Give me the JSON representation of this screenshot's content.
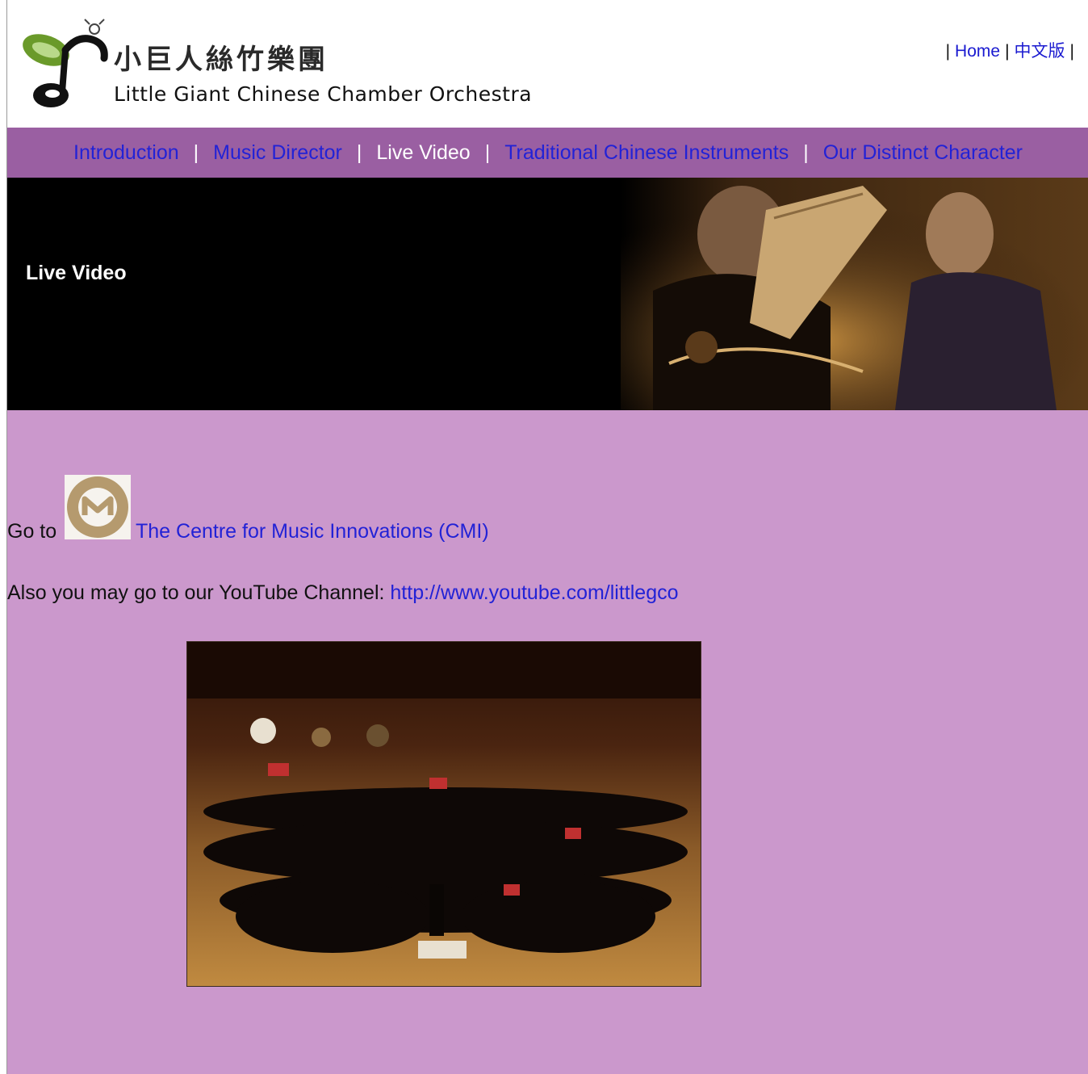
{
  "header": {
    "logo_cn": "小巨人絲竹樂團",
    "logo_en": "Little Giant Chinese Chamber Orchestra",
    "links": [
      {
        "label": "Home"
      },
      {
        "label": "中文版"
      }
    ],
    "separator": "|"
  },
  "nav": {
    "separator": "|",
    "items": [
      {
        "label": "Introduction",
        "active": false
      },
      {
        "label": "Music Director",
        "active": false
      },
      {
        "label": "Live Video",
        "active": true
      },
      {
        "label": "Traditional Chinese Instruments",
        "active": false
      },
      {
        "label": "Our Distinct Character",
        "active": false
      }
    ]
  },
  "banner": {
    "title": "Live Video"
  },
  "content": {
    "goto_prefix": "Go to",
    "cmi_link": "The Centre for Music Innovations (CMI)",
    "youtube_prefix": "Also you may go to our YouTube Channel:",
    "youtube_link": "http://www.youtube.com/littlegco"
  },
  "colors": {
    "nav_bg": "#9a5fa2",
    "content_bg": "#cb98cc",
    "link": "#2222d6",
    "active_nav": "#ffffff"
  }
}
